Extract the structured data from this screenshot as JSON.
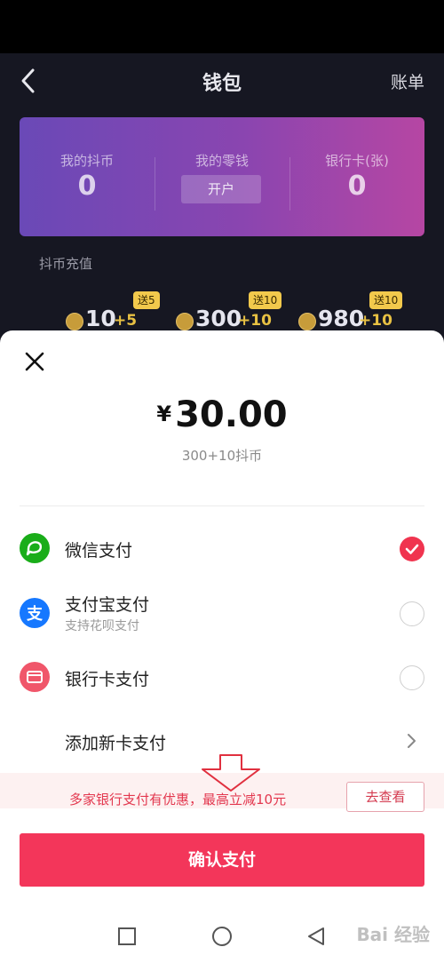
{
  "header": {
    "title": "钱包",
    "bill_label": "账单"
  },
  "balance": {
    "coins_label": "我的抖币",
    "coins_value": "0",
    "change_label": "我的零钱",
    "change_action": "开户",
    "cards_label": "银行卡(张)",
    "cards_value": "0"
  },
  "recharge": {
    "title": "抖币充值",
    "options": [
      {
        "amount": "10",
        "bonus": "+5",
        "badge": "送5"
      },
      {
        "amount": "300",
        "bonus": "+10",
        "badge": "送10"
      },
      {
        "amount": "980",
        "bonus": "+10",
        "badge": "送10"
      }
    ]
  },
  "sheet": {
    "currency": "¥",
    "amount": "30.00",
    "desc": "300+10抖币",
    "methods": [
      {
        "label": "微信支付",
        "selected": true
      },
      {
        "label": "支付宝支付",
        "sub": "支持花呗支付",
        "selected": false
      },
      {
        "label": "银行卡支付",
        "selected": false
      }
    ],
    "add_card": "添加新卡支付",
    "promo_text": "多家银行支付有优惠，最高立减10元",
    "promo_action": "去查看",
    "confirm_label": "确认支付"
  },
  "watermark": "Bai 经验",
  "colors": {
    "accent": "#f3365a",
    "wechat": "#1aad19",
    "alipay": "#1678ff",
    "bank": "#f0566a",
    "card_gradient_start": "#6a49b7",
    "card_gradient_end": "#b646a3"
  }
}
